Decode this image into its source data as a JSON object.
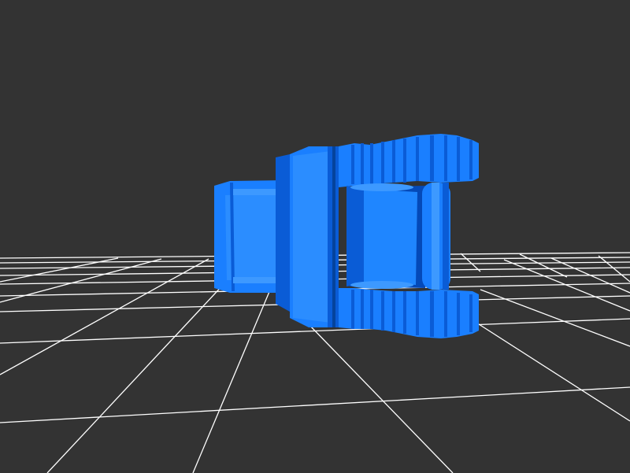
{
  "viewer": {
    "background_color": "#333333",
    "grid_color": "#ffffff",
    "model_color": "#1a7fff",
    "model_color_light": "#3d99ff",
    "model_color_dark": "#0a5cd6",
    "model_color_deep": "#0449b8",
    "object": {
      "shape": "blue-3d-model"
    }
  }
}
